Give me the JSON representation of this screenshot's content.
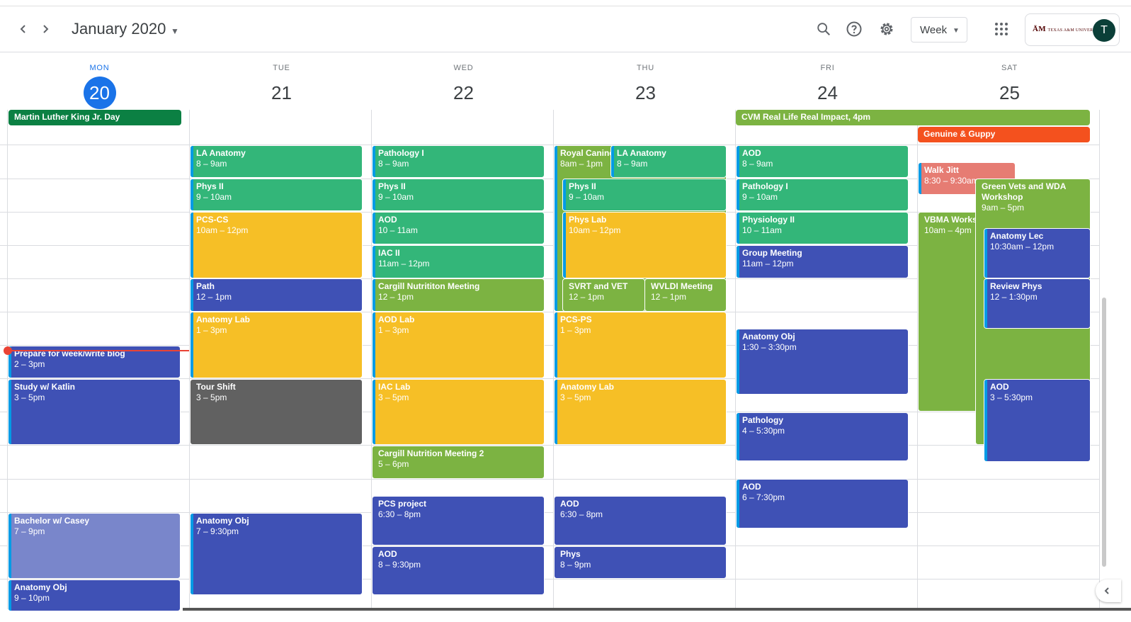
{
  "header": {
    "prev_icon": "chevron-left-icon",
    "next_icon": "chevron-right-icon",
    "month_title": "January 2020",
    "view_label": "Week",
    "org_logo_text": "TEXAS A&M UNIVERSITY",
    "avatar_initial": "T"
  },
  "days": [
    {
      "dow": "MON",
      "num": "20"
    },
    {
      "dow": "TUE",
      "num": "21"
    },
    {
      "dow": "WED",
      "num": "22"
    },
    {
      "dow": "THU",
      "num": "23"
    },
    {
      "dow": "FRI",
      "num": "24"
    },
    {
      "dow": "SAT",
      "num": "25"
    }
  ],
  "colors": {
    "green": "#33b679",
    "yellow": "#f6bf26",
    "blue": "#3f51b5",
    "olive": "#7cb342",
    "gray": "#616161",
    "lavender": "#7986cb",
    "flamingo": "#e67c73",
    "tangerine": "#f4511e",
    "basil": "#0b8043",
    "today": "#1a73e8",
    "now": "#ea4335"
  },
  "allday": {
    "mlk": "Martin Luther King Jr. Day",
    "cvm": "CVM Real Life Real Impact, 4pm",
    "genuine": "Genuine & Guppy"
  },
  "events": {
    "mon": {
      "prepare": {
        "title": "Prepare for week/write blog",
        "time": "2 – 3pm"
      },
      "study": {
        "title": "Study w/ Katlin",
        "time": "3 – 5pm"
      },
      "bachelor": {
        "title": "Bachelor w/ Casey",
        "time": "7 – 9pm"
      },
      "anatomy_obj": {
        "title": "Anatomy Obj",
        "time": "9 – 10pm"
      }
    },
    "tue": {
      "la_anatomy": {
        "title": "LA Anatomy",
        "time": "8 – 9am"
      },
      "phys2": {
        "title": "Phys II",
        "time": "9 – 10am"
      },
      "pcs_cs": {
        "title": "PCS-CS",
        "time": "10am – 12pm"
      },
      "path": {
        "title": "Path",
        "time": "12 – 1pm"
      },
      "anatomy_lab": {
        "title": "Anatomy Lab",
        "time": "1 – 3pm"
      },
      "tour_shift": {
        "title": "Tour Shift",
        "time": "3 – 5pm"
      },
      "anatomy_obj": {
        "title": "Anatomy Obj",
        "time": "7 – 9:30pm"
      }
    },
    "wed": {
      "pathology1": {
        "title": "Pathology I",
        "time": "8 – 9am"
      },
      "phys2": {
        "title": "Phys II",
        "time": "9 – 10am"
      },
      "aod": {
        "title": "AOD",
        "time": "10 – 11am"
      },
      "iac2": {
        "title": "IAC II",
        "time": "11am – 12pm"
      },
      "cargill": {
        "title": "Cargill Nutrititon Meeting",
        "time": "12 – 1pm"
      },
      "aod_lab": {
        "title": "AOD Lab",
        "time": "1 – 3pm"
      },
      "iac_lab": {
        "title": "IAC Lab",
        "time": "3 – 5pm"
      },
      "cargill2": {
        "title": "Cargill Nutrition Meeting 2",
        "time": "5 – 6pm"
      },
      "pcs_project": {
        "title": "PCS project",
        "time": "6:30 – 8pm"
      },
      "aod2": {
        "title": "AOD",
        "time": "8 – 9:30pm"
      }
    },
    "thu": {
      "royal_canine": {
        "title": "Royal Canine",
        "time": "8am – 1pm"
      },
      "la_anatomy": {
        "title": "LA Anatomy",
        "time": "8 – 9am"
      },
      "phys2": {
        "title": "Phys II",
        "time": "9 – 10am"
      },
      "phys_lab": {
        "title": "Phys Lab",
        "time": "10am – 12pm"
      },
      "svrt": {
        "title": "SVRT and VET",
        "time": "12 – 1pm"
      },
      "wvldi": {
        "title": "WVLDI Meeting",
        "time": "12 – 1pm"
      },
      "pcs_ps": {
        "title": "PCS-PS",
        "time": "1 – 3pm"
      },
      "anatomy_lab": {
        "title": "Anatomy Lab",
        "time": "3 – 5pm"
      },
      "aod": {
        "title": "AOD",
        "time": "6:30 – 8pm"
      },
      "phys": {
        "title": "Phys",
        "time": "8 – 9pm"
      }
    },
    "fri": {
      "aod": {
        "title": "AOD",
        "time": "8 – 9am"
      },
      "pathology1": {
        "title": "Pathology I",
        "time": "9 – 10am"
      },
      "physiology2": {
        "title": "Physiology II",
        "time": "10 – 11am"
      },
      "group_meeting": {
        "title": "Group Meeting",
        "time": "11am – 12pm"
      },
      "anatomy_obj": {
        "title": "Anatomy Obj",
        "time": "1:30 – 3:30pm"
      },
      "pathology": {
        "title": "Pathology",
        "time": "4 – 5:30pm"
      },
      "aod2": {
        "title": "AOD",
        "time": "6 – 7:30pm"
      }
    },
    "sat": {
      "walk_jitt": {
        "title": "Walk Jitt",
        "time": "8:30 – 9:30am"
      },
      "green_vets": {
        "title": "Green Vets and WDA Workshop",
        "time": "9am – 5pm"
      },
      "vbma": {
        "title": "VBMA Workshop",
        "time": "10am – 4pm"
      },
      "anatomy_lec": {
        "title": "Anatomy Lec",
        "time": "10:30am – 12pm"
      },
      "review_phys": {
        "title": "Review Phys",
        "time": "12 – 1:30pm"
      },
      "aod": {
        "title": "AOD",
        "time": "3 – 5:30pm"
      }
    }
  }
}
